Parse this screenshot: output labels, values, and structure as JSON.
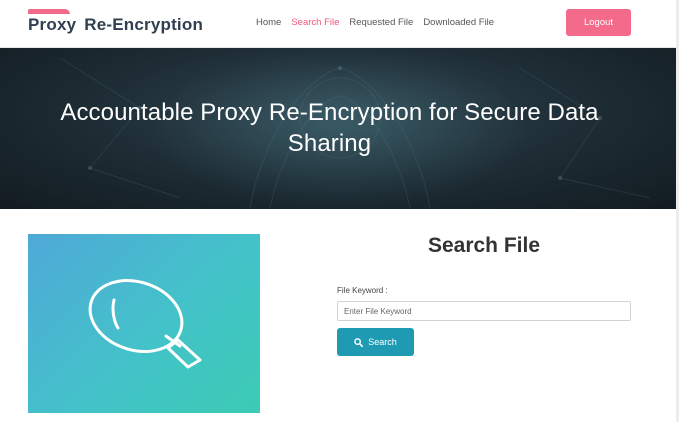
{
  "header": {
    "logo": {
      "word1": "Proxy",
      "word2": "Re-Encryption"
    },
    "nav": [
      {
        "label": "Home"
      },
      {
        "label": "Search File"
      },
      {
        "label": "Requested File"
      },
      {
        "label": "Downloaded File"
      }
    ],
    "logout_label": "Logout"
  },
  "hero": {
    "title_line1": "Accountable Proxy Re-Encryption for Secure Data",
    "title_line2": "Sharing"
  },
  "form": {
    "title": "Search File",
    "keyword_label": "File Keyword :",
    "keyword_placeholder": "Enter File Keyword",
    "keyword_value": "",
    "search_label": "Search"
  },
  "colors": {
    "brand_pink": "#f36a8a",
    "nav_active": "#f3557a",
    "search_button": "#1f9ab3",
    "hero_dark": "#1d2b33"
  },
  "icons": {
    "hero_image": "magnifying-glass-icon",
    "search_button": "search-icon"
  }
}
